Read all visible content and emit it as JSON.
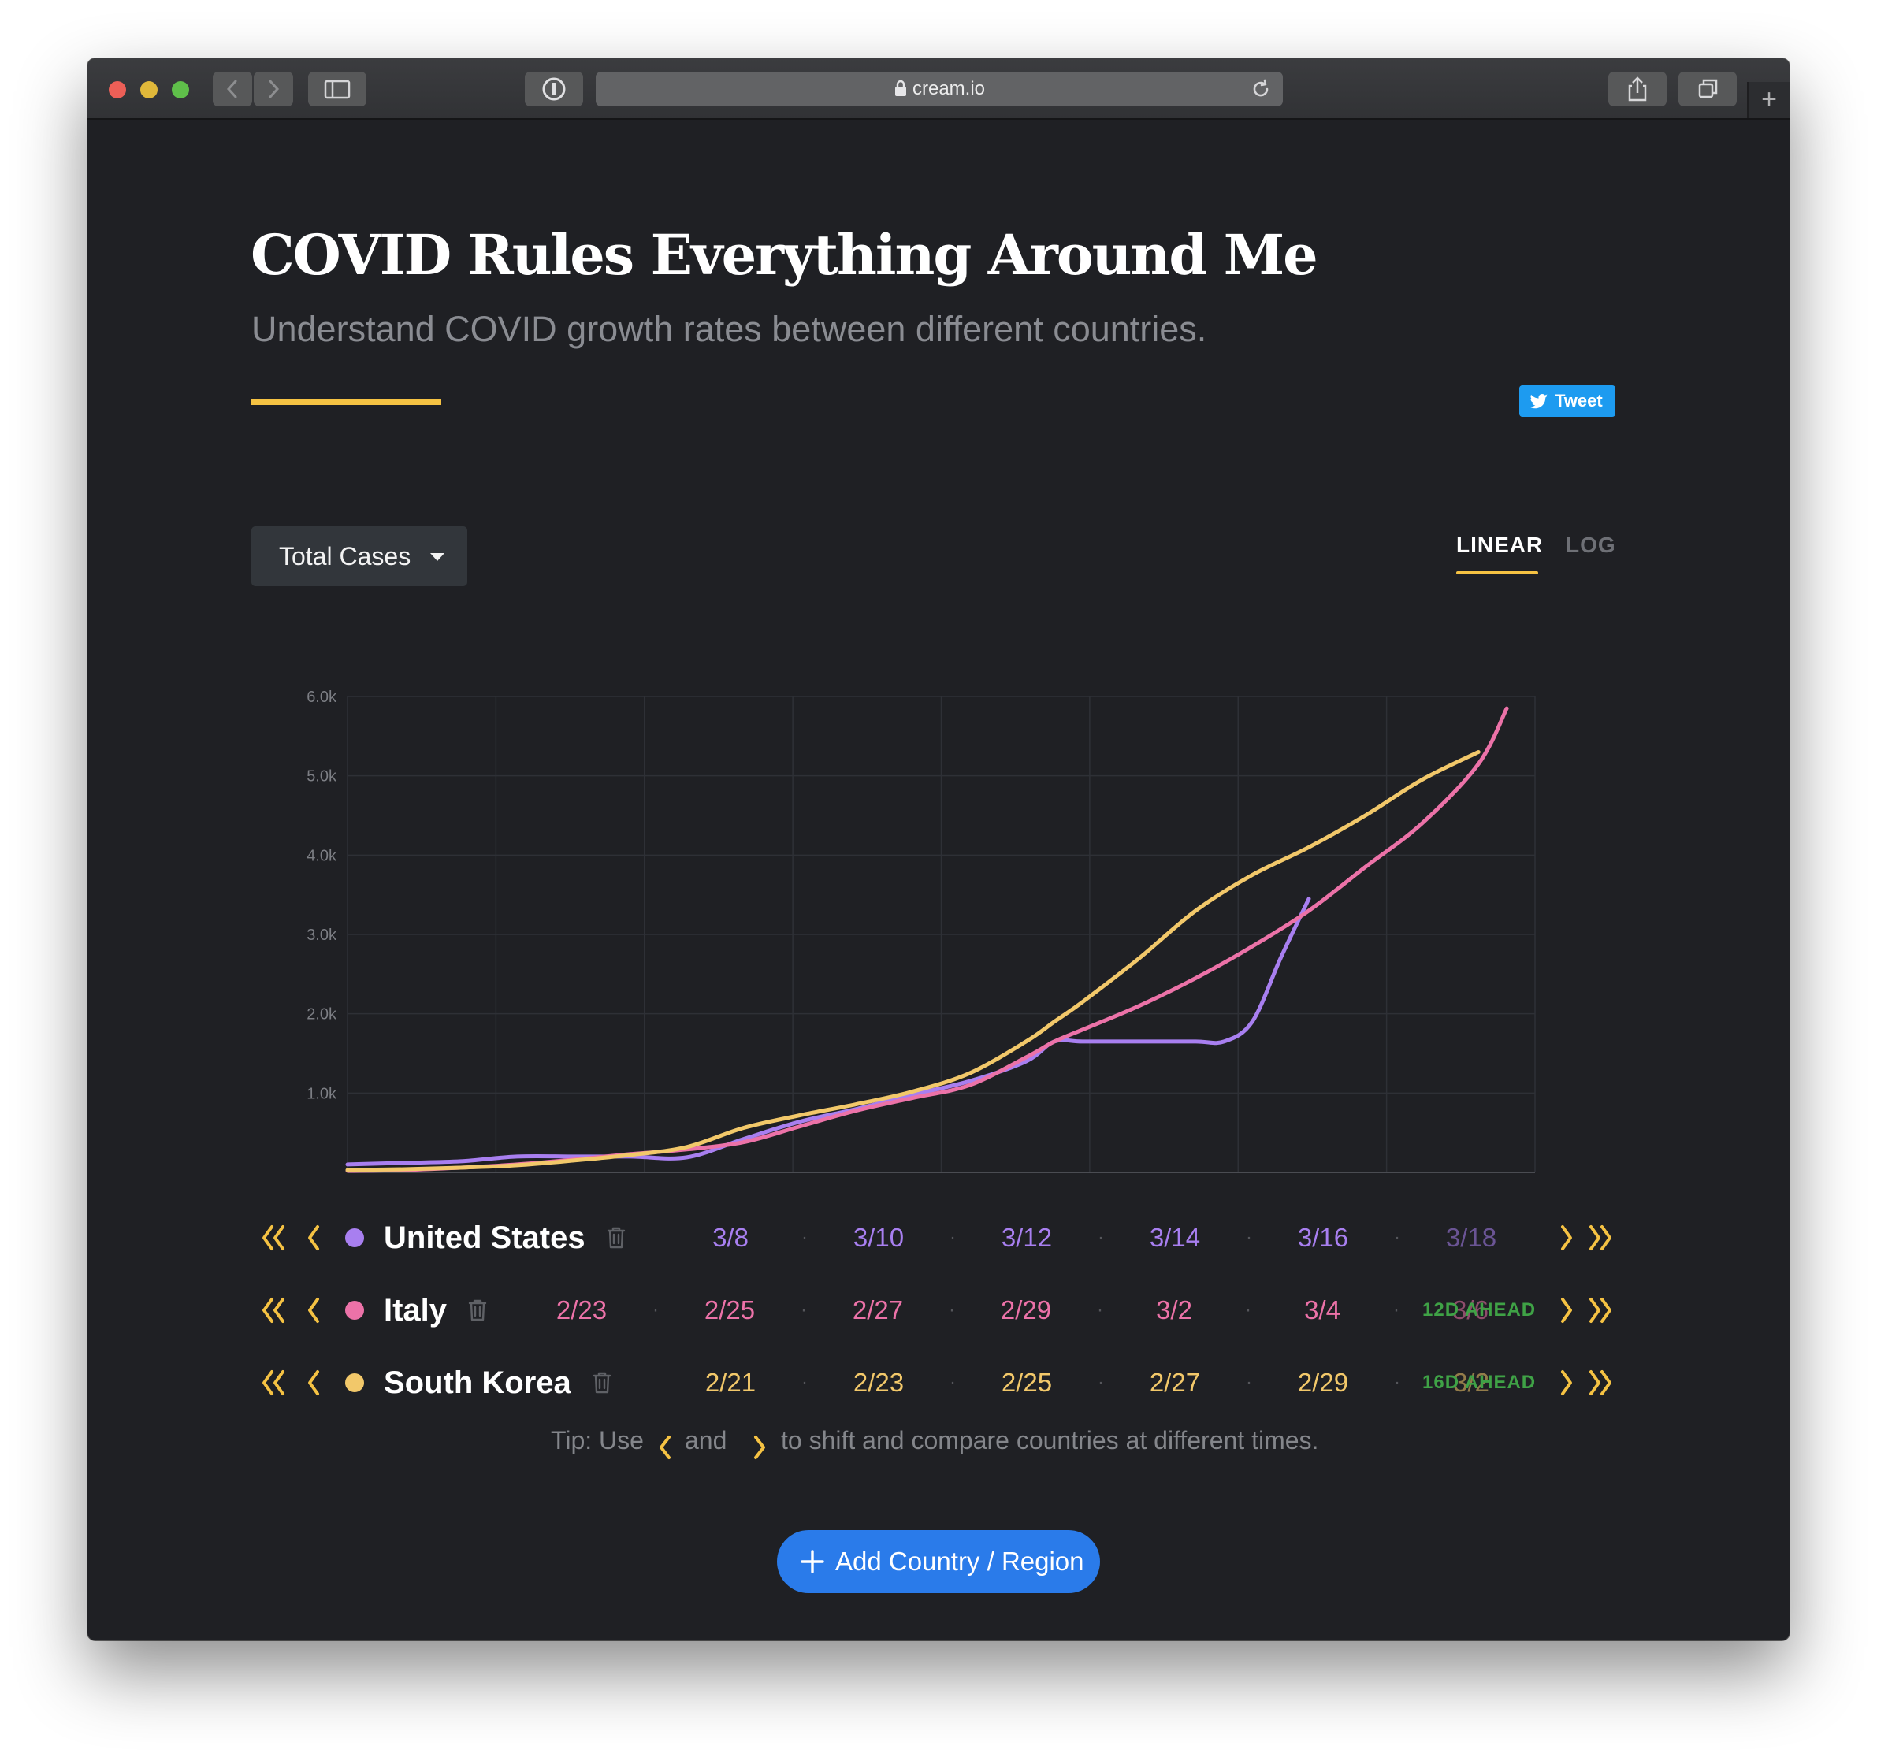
{
  "browser": {
    "url": "cream.io"
  },
  "page": {
    "title": "COVID Rules Everything Around Me",
    "subtitle": "Understand COVID growth rates between different countries.",
    "tweet_label": "Tweet"
  },
  "controls": {
    "metric_label": "Total Cases",
    "scale_linear": "LINEAR",
    "scale_log": "LOG",
    "active_scale": "LINEAR"
  },
  "chart_data": {
    "type": "line",
    "y_ticks": [
      "1.0k",
      "2.0k",
      "3.0k",
      "4.0k",
      "5.0k",
      "6.0k"
    ],
    "ylim": [
      0,
      6000
    ],
    "grid": true,
    "series": [
      {
        "name": "United States",
        "color": "#a87ff0",
        "values": [
          [
            0,
            100
          ],
          [
            2,
            120
          ],
          [
            4,
            140
          ],
          [
            6,
            200
          ],
          [
            8,
            200
          ],
          [
            10,
            200
          ],
          [
            12,
            190
          ],
          [
            14,
            420
          ],
          [
            16,
            640
          ],
          [
            18,
            800
          ],
          [
            20,
            980
          ],
          [
            22,
            1150
          ],
          [
            24,
            1400
          ],
          [
            25,
            1650
          ],
          [
            26,
            1650
          ],
          [
            28,
            1650
          ],
          [
            30,
            1650
          ],
          [
            31,
            1650
          ],
          [
            32,
            1900
          ],
          [
            33,
            2700
          ],
          [
            34,
            3450
          ]
        ]
      },
      {
        "name": "Italy",
        "color": "#ec72a8",
        "values": [
          [
            0,
            20
          ],
          [
            2,
            30
          ],
          [
            4,
            60
          ],
          [
            6,
            100
          ],
          [
            8,
            160
          ],
          [
            10,
            230
          ],
          [
            12,
            290
          ],
          [
            14,
            380
          ],
          [
            16,
            580
          ],
          [
            18,
            780
          ],
          [
            20,
            940
          ],
          [
            22,
            1100
          ],
          [
            24,
            1450
          ],
          [
            25,
            1650
          ],
          [
            26,
            1800
          ],
          [
            28,
            2100
          ],
          [
            30,
            2450
          ],
          [
            32,
            2850
          ],
          [
            34,
            3300
          ],
          [
            36,
            3850
          ],
          [
            38,
            4400
          ],
          [
            40,
            5150
          ],
          [
            41,
            5850
          ]
        ]
      },
      {
        "name": "South Korea",
        "color": "#f2c86a",
        "values": [
          [
            0,
            30
          ],
          [
            2,
            40
          ],
          [
            4,
            60
          ],
          [
            6,
            90
          ],
          [
            8,
            150
          ],
          [
            10,
            220
          ],
          [
            12,
            320
          ],
          [
            14,
            560
          ],
          [
            16,
            720
          ],
          [
            18,
            860
          ],
          [
            20,
            1020
          ],
          [
            22,
            1250
          ],
          [
            24,
            1650
          ],
          [
            25,
            1900
          ],
          [
            26,
            2150
          ],
          [
            28,
            2700
          ],
          [
            30,
            3300
          ],
          [
            32,
            3750
          ],
          [
            34,
            4100
          ],
          [
            36,
            4500
          ],
          [
            38,
            4950
          ],
          [
            40,
            5300
          ]
        ]
      }
    ]
  },
  "countries": [
    {
      "name": "United States",
      "color": "#a87ff0",
      "dates": [
        "3/8",
        "3/10",
        "3/12",
        "3/14",
        "3/16",
        "3/18"
      ],
      "ahead": ""
    },
    {
      "name": "Italy",
      "color": "#ec72a8",
      "dates": [
        "2/23",
        "2/25",
        "2/27",
        "2/29",
        "3/2",
        "3/4",
        "3/6"
      ],
      "ahead": "12D AHEAD"
    },
    {
      "name": "South Korea",
      "color": "#f2c86a",
      "dates": [
        "2/21",
        "2/23",
        "2/25",
        "2/27",
        "2/29",
        "3/2"
      ],
      "ahead": "16D AHEAD"
    }
  ],
  "tip": {
    "prefix": "Tip: Use",
    "middle": "and",
    "suffix": "to shift and compare countries at different times."
  },
  "add_button_label": "Add Country / Region",
  "colors": {
    "accent": "#f5c243",
    "primary_button": "#2a7bea",
    "ahead_green": "#3fa246"
  }
}
